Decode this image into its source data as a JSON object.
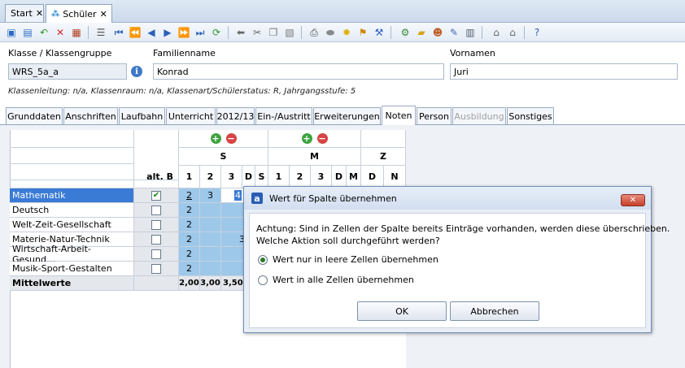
{
  "doc_tabs": [
    {
      "label": "Start",
      "close": "✕"
    },
    {
      "label": "Schüler",
      "close": "✕"
    }
  ],
  "toolbar_icons": [
    "new-icon",
    "save-icon",
    "undo-icon",
    "delete-icon",
    "form-icon",
    "list-icon",
    "first-icon",
    "prev-page-icon",
    "prev-icon",
    "next-icon",
    "next-page-icon",
    "last-icon",
    "refresh-icon",
    "back-arrow-icon",
    "cut-icon",
    "copy-icon",
    "paste-icon",
    "print-icon",
    "oval-icon",
    "bulb-icon",
    "broom-icon",
    "tools-icon",
    "folder-icon",
    "user-icon",
    "edit-icon",
    "report-icon",
    "house-icon",
    "house2-icon",
    "help-icon"
  ],
  "form": {
    "klasse_label": "Klasse / Klassengruppe",
    "klasse_value": "WRS_5a_a",
    "familienname_label": "Familienname",
    "familienname_value": "Konrad",
    "vornamen_label": "Vornamen",
    "vornamen_value": "Juri",
    "info_icon": "i",
    "meta": "Klassenleitung: n/a, Klassenraum: n/a, Klassenart/Schülerstatus: R, Jahrgangsstufe: 5"
  },
  "subtabs": [
    {
      "label": "Grunddaten"
    },
    {
      "label": "Anschriften"
    },
    {
      "label": "Laufbahn"
    },
    {
      "label": "Unterricht"
    },
    {
      "label": "2012/13"
    },
    {
      "label": "Ein-/Austritt"
    },
    {
      "label": "Erweiterungen"
    },
    {
      "label": "Noten"
    },
    {
      "label": "Person"
    },
    {
      "label": "Ausbildung"
    },
    {
      "label": "Sonstiges"
    }
  ],
  "grid": {
    "groups": [
      "S",
      "M",
      "Z"
    ],
    "altb_label": "alt. B",
    "s_cols": [
      "1",
      "2",
      "3",
      "D",
      "S"
    ],
    "m_cols": [
      "1",
      "2",
      "3",
      "D",
      "M"
    ],
    "z_cols": [
      "D",
      "N"
    ],
    "plus": "+",
    "minus": "−",
    "rows": [
      {
        "subject": "Mathematik",
        "checked": "✔",
        "s1": "2",
        "s2": "3",
        "s3": "4"
      },
      {
        "subject": "Deutsch",
        "checked": "",
        "s1": "2",
        "s2": "",
        "s3": ""
      },
      {
        "subject": "Welt-Zeit-Gesellschaft",
        "checked": "",
        "s1": "2",
        "s2": "",
        "s3": ""
      },
      {
        "subject": "Materie-Natur-Technik",
        "checked": "",
        "s1": "2",
        "s2": "",
        "s3": "3"
      },
      {
        "subject": "Wirtschaft-Arbeit-Gesund…",
        "checked": "",
        "s1": "2",
        "s2": "",
        "s3": ""
      },
      {
        "subject": "Musik-Sport-Gestalten",
        "checked": "",
        "s1": "2",
        "s2": "",
        "s3": ""
      }
    ],
    "mittel_label": "Mittelwerte",
    "mittel": [
      "2,00",
      "3,00",
      "3,50"
    ]
  },
  "dialog": {
    "logo": "a",
    "title": "Wert für Spalte übernehmen",
    "close": "✕",
    "message_line1": "Achtung: Sind in Zellen der Spalte bereits Einträge vorhanden, werden diese überschrieben.",
    "message_line2": "Welche Aktion soll durchgeführt werden?",
    "option1": "Wert nur in leere Zellen übernehmen",
    "option2": "Wert in alle Zellen übernehmen",
    "ok": "OK",
    "cancel": "Abbrechen"
  }
}
